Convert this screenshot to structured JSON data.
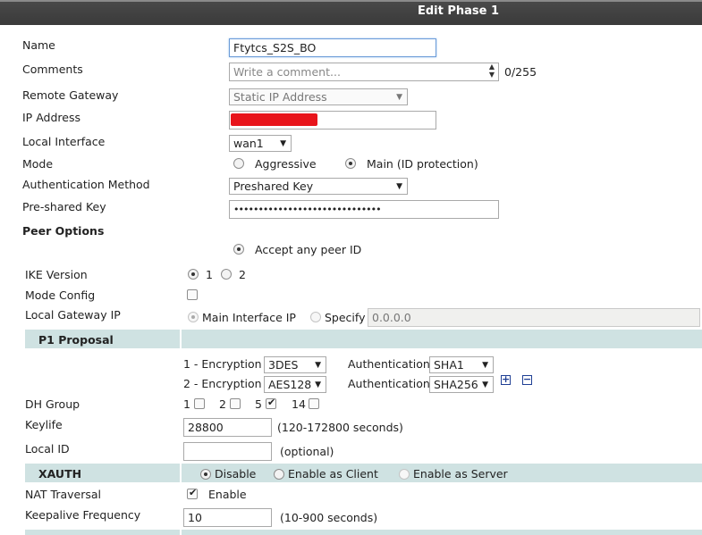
{
  "dialog": {
    "title": "Edit Phase 1"
  },
  "fields": {
    "name": {
      "label": "Name",
      "value": "Ftytcs_S2S_BO"
    },
    "comments": {
      "label": "Comments",
      "placeholder": "Write a comment...",
      "counter": "0/255"
    },
    "remote_gateway": {
      "label": "Remote Gateway",
      "value": "Static IP Address"
    },
    "ip_address": {
      "label": "IP Address",
      "value": ""
    },
    "local_interface": {
      "label": "Local Interface",
      "value": "wan1"
    },
    "mode": {
      "label": "Mode",
      "options": [
        "Aggressive",
        "Main (ID protection)"
      ],
      "selected": "Main (ID protection)"
    },
    "auth_method": {
      "label": "Authentication Method",
      "value": "Preshared Key"
    },
    "psk": {
      "label": "Pre-shared Key",
      "value": "••••••••••••••••••••••••••••••"
    }
  },
  "peer_options": {
    "heading": "Peer Options",
    "accept_any": "Accept any peer ID"
  },
  "ike": {
    "label": "IKE Version",
    "options": [
      "1",
      "2"
    ],
    "selected": "1"
  },
  "mode_config": {
    "label": "Mode Config",
    "checked": false
  },
  "local_gateway": {
    "label": "Local Gateway IP",
    "main": "Main Interface IP",
    "specify": "Specify",
    "value": "0.0.0.0"
  },
  "p1_proposal": {
    "heading": "P1 Proposal",
    "rows": [
      {
        "enc_label": "1 - Encryption",
        "enc": "3DES",
        "auth_label": "Authentication",
        "auth": "SHA1"
      },
      {
        "enc_label": "2 - Encryption",
        "enc": "AES128",
        "auth_label": "Authentication",
        "auth": "SHA256"
      }
    ]
  },
  "dh_group": {
    "label": "DH Group",
    "options": [
      {
        "label": "1",
        "checked": false
      },
      {
        "label": "2",
        "checked": false
      },
      {
        "label": "5",
        "checked": true
      },
      {
        "label": "14",
        "checked": false
      }
    ]
  },
  "keylife": {
    "label": "Keylife",
    "value": "28800",
    "hint": "(120-172800 seconds)"
  },
  "local_id": {
    "label": "Local ID",
    "value": "",
    "hint": "(optional)"
  },
  "xauth": {
    "heading": "XAUTH",
    "options": [
      "Disable",
      "Enable as Client",
      "Enable as Server"
    ],
    "selected": "Disable"
  },
  "nat_traversal": {
    "label": "NAT Traversal",
    "option": "Enable",
    "checked": true
  },
  "keepalive": {
    "label": "Keepalive Frequency",
    "value": "10",
    "hint": "(10-900 seconds)"
  },
  "colors": {
    "band": "#cfe2e2",
    "redaction": "#e8141b",
    "header": "#3f3f3f",
    "icon": "#1f3f94"
  }
}
